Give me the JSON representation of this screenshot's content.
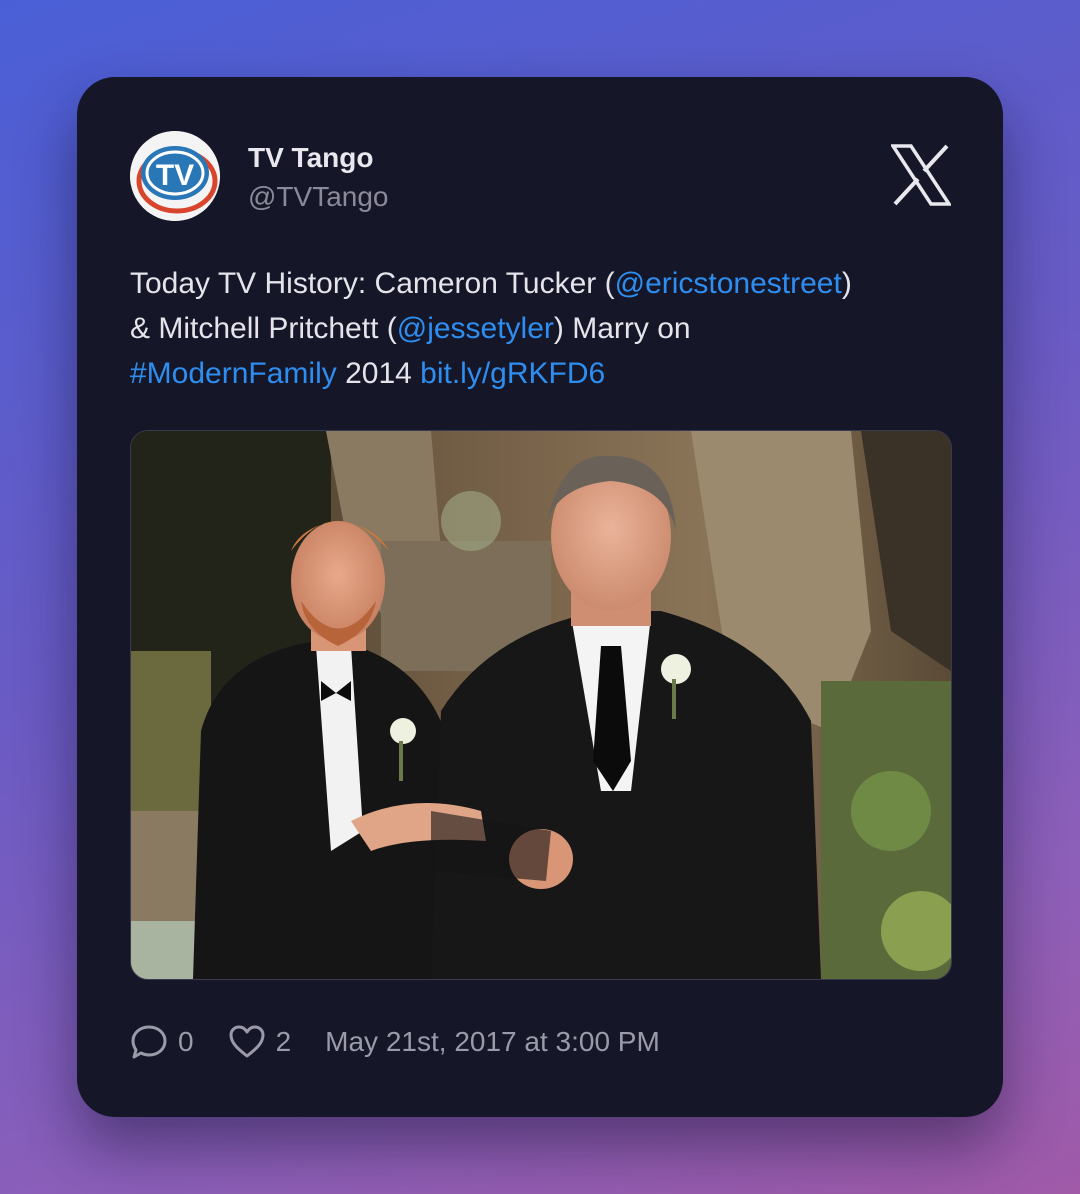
{
  "tweet": {
    "author_name": "TV Tango",
    "author_handle": "@TVTango",
    "avatar_text": "TV",
    "text_parts": {
      "p1": "Today TV History: Cameron Tucker (",
      "m1": "@ericstonestreet",
      "p2": ")",
      "p3": "& Mitchell Pritchett (",
      "m2": "@jessetyler",
      "p4": ") Marry on",
      "hashtag": "#ModernFamily",
      "p5": " 2014 ",
      "url": "bit.ly/gRKFD6"
    },
    "reply_count": "0",
    "like_count": "2",
    "timestamp": "May 21st, 2017 at 3:00 PM"
  },
  "icons": {
    "platform": "x-logo-icon",
    "reply": "reply-icon",
    "like": "heart-icon"
  },
  "colors": {
    "card_bg": "#161629",
    "link": "#2e8ef0",
    "text": "#e4e4ea",
    "muted": "#8a8a99"
  }
}
